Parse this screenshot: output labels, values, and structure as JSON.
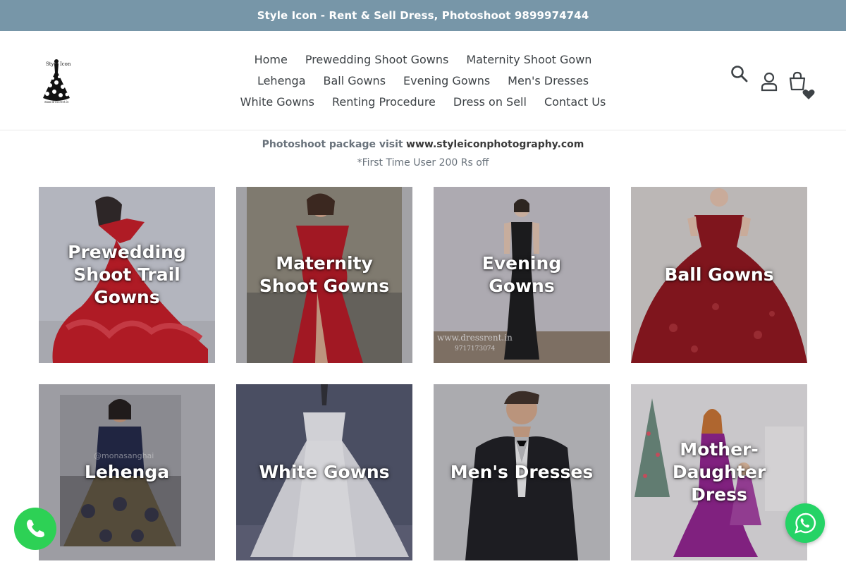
{
  "announcement": "Style Icon - Rent & Sell Dress, Photoshoot 9899974744",
  "logo": {
    "text": "Style Icon",
    "url_text": "www.dressrent.in"
  },
  "nav": {
    "row1": [
      "Home",
      "Prewedding Shoot Gowns",
      "Maternity Shoot Gown"
    ],
    "row2": [
      "Lehenga",
      "Ball Gowns",
      "Evening Gowns",
      "Men's Dresses"
    ],
    "row3": [
      "White Gowns",
      "Renting Procedure",
      "Dress on Sell",
      "Contact Us"
    ]
  },
  "header_icons": [
    "search-icon",
    "account-icon",
    "cart-icon",
    "heart-icon"
  ],
  "promo": {
    "prefix": "Photoshoot package visit",
    "site": "www.styleiconphotography.com",
    "sub": "*First Time User 200 Rs off"
  },
  "collections": [
    {
      "label": "Prewedding Shoot Trail Gowns",
      "bg": "#cfd1d8",
      "dress": "#c8141e"
    },
    {
      "label": "Maternity Shoot Gowns",
      "bg": "#8e8878",
      "dress": "#b8101c"
    },
    {
      "label": "Evening Gowns",
      "bg": "#c6c3c8",
      "dress": "#141414",
      "watermark": "www.dressrent.in",
      "watermark2": "9717173074"
    },
    {
      "label": "Ball Gowns",
      "bg": "#d7d2cf",
      "dress": "#8e0d14"
    },
    {
      "label": "Lehenga",
      "bg": "#a9a9ad",
      "dress": "#1a2040",
      "watermark": "@monasanghai"
    },
    {
      "label": "White Gowns",
      "bg": "#4e5268",
      "dress": "#f1f1f4"
    },
    {
      "label": "Men's Dresses",
      "bg": "#c4c4c6",
      "dress": "#16171a"
    },
    {
      "label": "Mother-Daughter Dress",
      "bg": "#e8e6e7",
      "dress": "#8f1c8c"
    }
  ],
  "colors": {
    "announcement_bg": "#7796a8",
    "phone_fab": "#2dd155",
    "whatsapp_fab": "#25d366"
  }
}
